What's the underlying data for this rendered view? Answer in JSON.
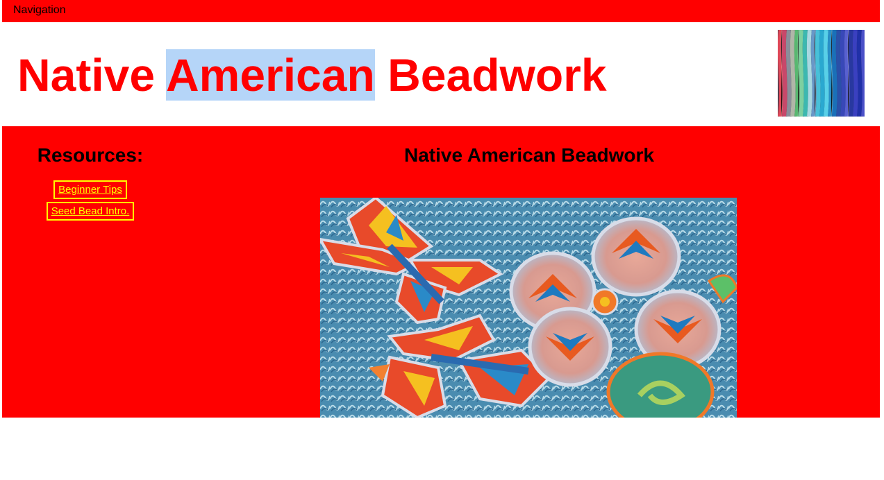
{
  "nav": {
    "label": "Navigation"
  },
  "header": {
    "title_part1": "Native ",
    "title_highlight": "American",
    "title_part2": " Beadwork",
    "image": "colorful-thread-spools"
  },
  "sidebar": {
    "heading": "Resources:",
    "links": [
      {
        "label": "Beginner Tips"
      },
      {
        "label": "Seed Bead Intro."
      }
    ]
  },
  "content": {
    "heading": "Native American Beadwork",
    "image": "beaded-butterflies-and-medallions"
  },
  "colors": {
    "accent": "#ff0000",
    "link": "#ffff00",
    "selection": "#b5d5f8"
  }
}
